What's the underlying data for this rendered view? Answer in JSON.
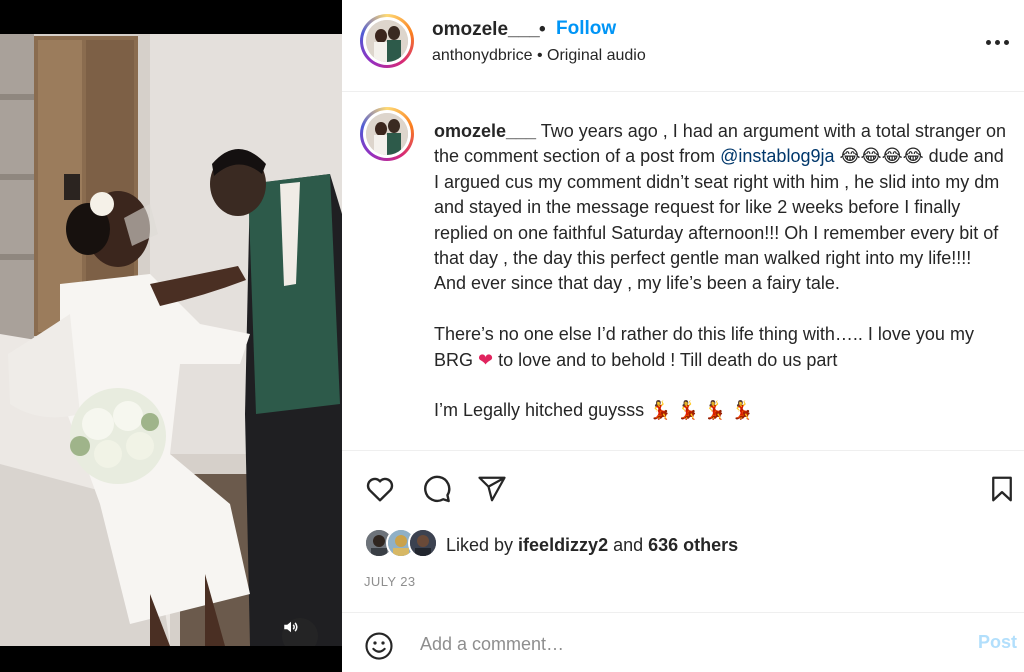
{
  "colors": {
    "accent": "#0095f6",
    "mention": "#00376b",
    "muted": "#8e8e8e",
    "post_disabled": "#b2dffc",
    "heart_emoji": "#e0245e"
  },
  "header": {
    "username": "omozele___",
    "separator": "•",
    "follow_label": "Follow",
    "audio_owner": "anthonydbrice",
    "audio_separator": "•",
    "audio_label": "Original audio",
    "more_icon": "more-horizontal-icon"
  },
  "caption": {
    "author": "omozele___",
    "part1": " Two years ago , I had an argument with a total stranger on the comment section of a post from ",
    "mention": "@instablog9ja",
    "emojis1": " 😂😂😂😂 ",
    "part2": "dude and I argued cus my comment didn’t seat right with him , he slid into my dm and stayed in the message request for like 2 weeks before I finally replied on one faithful Saturday afternoon!!! Oh I remember every bit of that day , the day this perfect gentle man walked right into my life!!!! And ever since that day , my life’s been a fairy tale.",
    "para2_a": "There’s no one else I’d rather do this life thing with….. I love you my BRG ",
    "para2_heart": "❤",
    "para2_b": " to love and to behold ! Till death do us part",
    "para3_text": "I’m Legally hitched guysss ",
    "para3_emojis": "💃 💃 💃 💃"
  },
  "actions": {
    "like_icon": "heart-icon",
    "comment_icon": "comment-icon",
    "share_icon": "send-icon",
    "save_icon": "bookmark-icon"
  },
  "likes": {
    "prefix": "Liked by ",
    "user": "ifeeldizzy2",
    "middle": " and ",
    "others": "636 others"
  },
  "date": "JULY 23",
  "comment_box": {
    "emoji_icon": "smiley-icon",
    "placeholder": "Add a comment…",
    "post_label": "Post"
  },
  "media": {
    "mute_icon": "speaker-icon"
  }
}
